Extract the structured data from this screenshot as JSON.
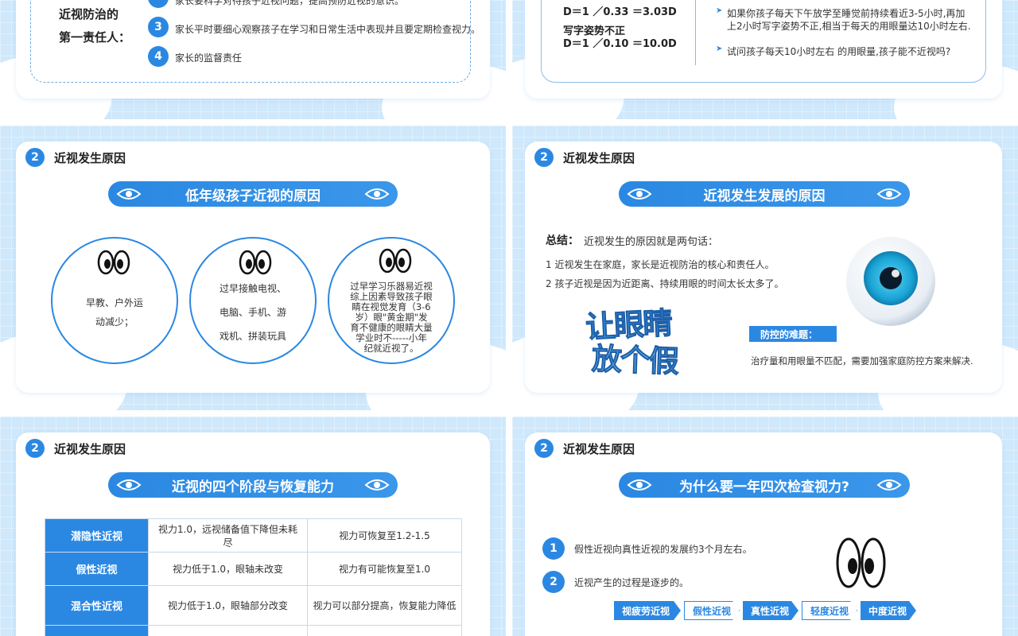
{
  "slide1": {
    "title_line1": "近视防治的",
    "title_line2": "第一责任人：",
    "item_partial": "家长要科学对待孩子近视问题，提高预防近视的意识。",
    "items": [
      {
        "num": "3",
        "text": "家长平时要细心观察孩子在学习和日常生活中表现并且要定期检查视力。"
      },
      {
        "num": "4",
        "text": "家长的监督责任"
      }
    ]
  },
  "slide2": {
    "formula1": "D＝1 ／0.33 ＝3.03D",
    "label2": "写字姿势不正",
    "formula2": "D＝1 ／0.10 ＝10.0D",
    "bullet1_line1": "如果你孩子每天下午放学至睡觉前持续看近3-5小时,再加",
    "bullet1_line2": "上2小时写字姿势不正,相当于每天的用眼量达10小时左右.",
    "bullet2": "试问孩子每天10小时左右 的用眼量,孩子能不近视吗?"
  },
  "slide3": {
    "num": "2",
    "section": "近视发生原因",
    "banner": "低年级孩子近视的原因",
    "circle1_line1": "早教、户外运",
    "circle1_line2": "动减少；",
    "circle2_line1": "过早接触电视、",
    "circle2_line2": "电脑、手机、游",
    "circle2_line3": "戏机、拼装玩具",
    "circle3_lines": [
      "过早学习乐器易近视",
      "综上因素导致孩子眼",
      "睛在视觉发育（3-6",
      "岁）眼\"黄金期\"发",
      "育不健康的眼睛大量",
      "学业时不-----小年",
      "纪就近视了。"
    ]
  },
  "slide4": {
    "num": "2",
    "section": "近视发生原因",
    "banner": "近视发生发展的原因",
    "summary_label": "总结：",
    "summary_text": "近视发生的原因就是两句话：",
    "point1": "1 近视发生在家庭，家长是近视防治的核心和责任人。",
    "point2": "2 孩子近视是因为近距离、持续用眼的时间太长太多了。",
    "art_line1": "让眼睛",
    "art_line2": "放个假",
    "difficulty_label": "防控的难题：",
    "difficulty_text": "治疗量和用眼量不匹配，需要加强家庭防控方案来解决."
  },
  "slide5": {
    "num": "2",
    "section": "近视发生原因",
    "banner": "近视的四个阶段与恢复能力",
    "rows": [
      {
        "stage": "潜隐性近视",
        "desc": "视力1.0，远视储备值下降但未耗尽",
        "recovery": "视力可恢复至1.2-1.5"
      },
      {
        "stage": "假性近视",
        "desc": "视力低于1.0，眼轴未改变",
        "recovery": "视力有可能恢复至1.0"
      },
      {
        "stage": "混合性近视",
        "desc": "视力低于1.0，眼轴部分改变",
        "recovery": "视力可以部分提高，恢复能力降低"
      },
      {
        "stage": "",
        "desc": "",
        "recovery": ""
      }
    ]
  },
  "slide6": {
    "num": "2",
    "section": "近视发生原因",
    "banner": "为什么要一年四次检查视力?",
    "point1_num": "1",
    "point1": "假性近视向真性近视的发展约3个月左右。",
    "point2_num": "2",
    "point2": "近视产生的过程是逐步的。",
    "chips": [
      "视疲劳近视",
      "假性近视",
      "真性近视",
      "轻度近视",
      "中度近视"
    ]
  },
  "colors": {
    "primary": "#2b88e2",
    "bg": "#cfe8fb"
  }
}
